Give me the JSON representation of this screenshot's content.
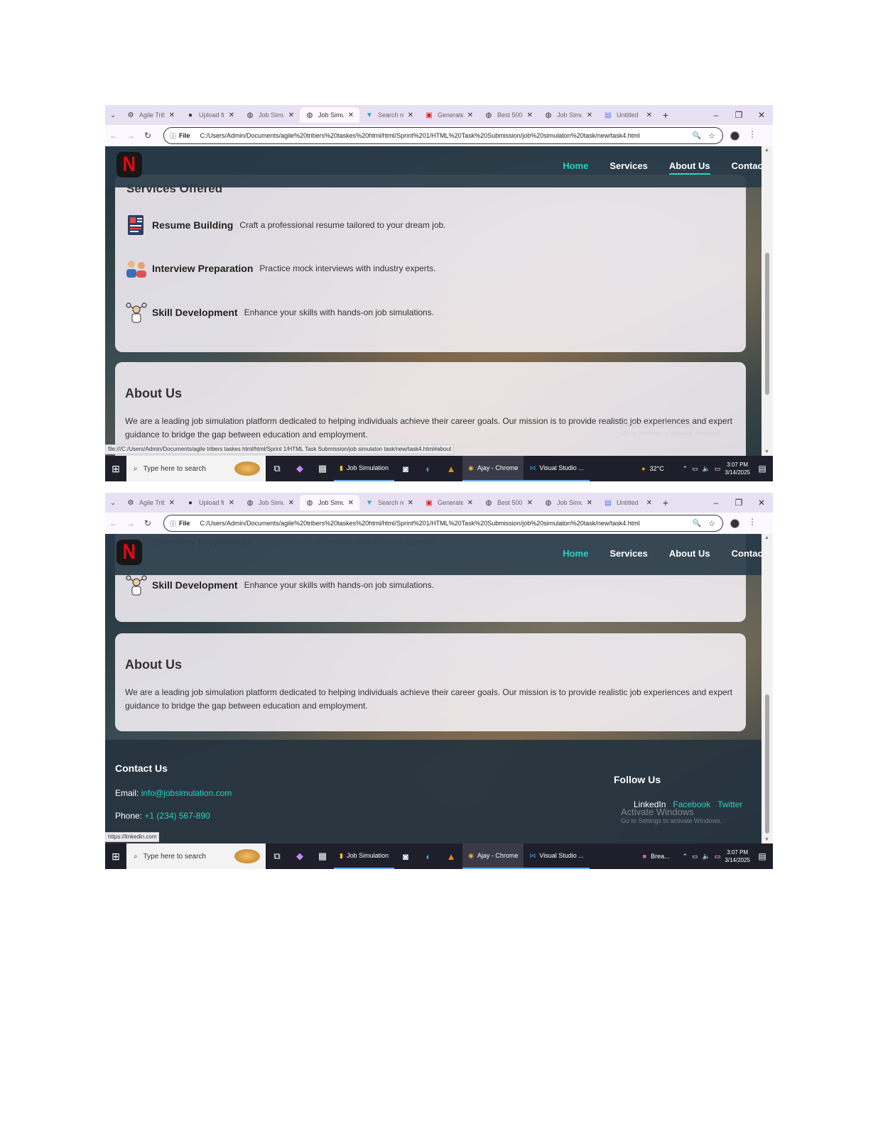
{
  "browser": {
    "tabs": [
      {
        "title": "Agile Trib",
        "icon": "gear-icon"
      },
      {
        "title": "Upload fi",
        "icon": "github-icon"
      },
      {
        "title": "Job Simu",
        "icon": "globe-icon"
      },
      {
        "title": "Job Simu",
        "icon": "globe-icon",
        "active": true
      },
      {
        "title": "Search re",
        "icon": "vercel-icon"
      },
      {
        "title": "Generate",
        "icon": "pdf-icon"
      },
      {
        "title": "Best 500",
        "icon": "globe-icon"
      },
      {
        "title": "Job Simu",
        "icon": "globe-icon"
      },
      {
        "title": "Untitled",
        "icon": "doc-icon"
      }
    ],
    "new_tab": "+",
    "address_chip": "File",
    "url": "C:/Users/Admin/Documents/agile%20tribers%20taskes%20html/html/Sprint%201/HTML%20Task%20Submission/job%20simulaton%20task/new/task4.html"
  },
  "site": {
    "logo": "N",
    "nav": [
      "Home",
      "Services",
      "About Us",
      "Contact"
    ],
    "services_heading": "Services Offered",
    "services": [
      {
        "name": "Resume Building",
        "desc": "Craft a professional resume tailored to your dream job."
      },
      {
        "name": "Interview Preparation",
        "desc": "Practice mock interviews with industry experts."
      },
      {
        "name": "Skill Development",
        "desc": "Enhance your skills with hands-on job simulations."
      }
    ],
    "about_title": "About Us",
    "about_text": "We are a leading job simulation platform dedicated to helping individuals achieve their career goals. Our mission is to provide realistic job experiences and expert guidance to bridge the gap between education and employment.",
    "contact_title": "Contact Us",
    "email_label": "Email:",
    "email": "info@jobsimulation.com",
    "phone_label": "Phone:",
    "phone": "+1 (234) 567-890",
    "follow_title": "Follow Us",
    "social": [
      "LinkedIn",
      "Facebook",
      "Twitter"
    ]
  },
  "status_urls": {
    "shot1": "file:///C:/Users/Admin/Documents/agile tribers taskes html/html/Sprint 1/HTML Task Submission/job simulaton task/new/task4.html#about",
    "shot2": "https://linkedin.com"
  },
  "watermark": {
    "title": "Activate Windows",
    "subtitle": "Go to Settings to activate Windows."
  },
  "taskbar": {
    "search_placeholder": "Type here to search",
    "apps": [
      "Job Simulation",
      "Ajay - Chrome",
      "Visual Studio ..."
    ],
    "weather": "32°C",
    "extra_app_shot2": "Brea...",
    "time": "3:07 PM",
    "date": "3/14/2025"
  },
  "colors": {
    "accent": "#2bd1c0",
    "netflix_red": "#e50914",
    "nav_bg": "#283a46"
  }
}
